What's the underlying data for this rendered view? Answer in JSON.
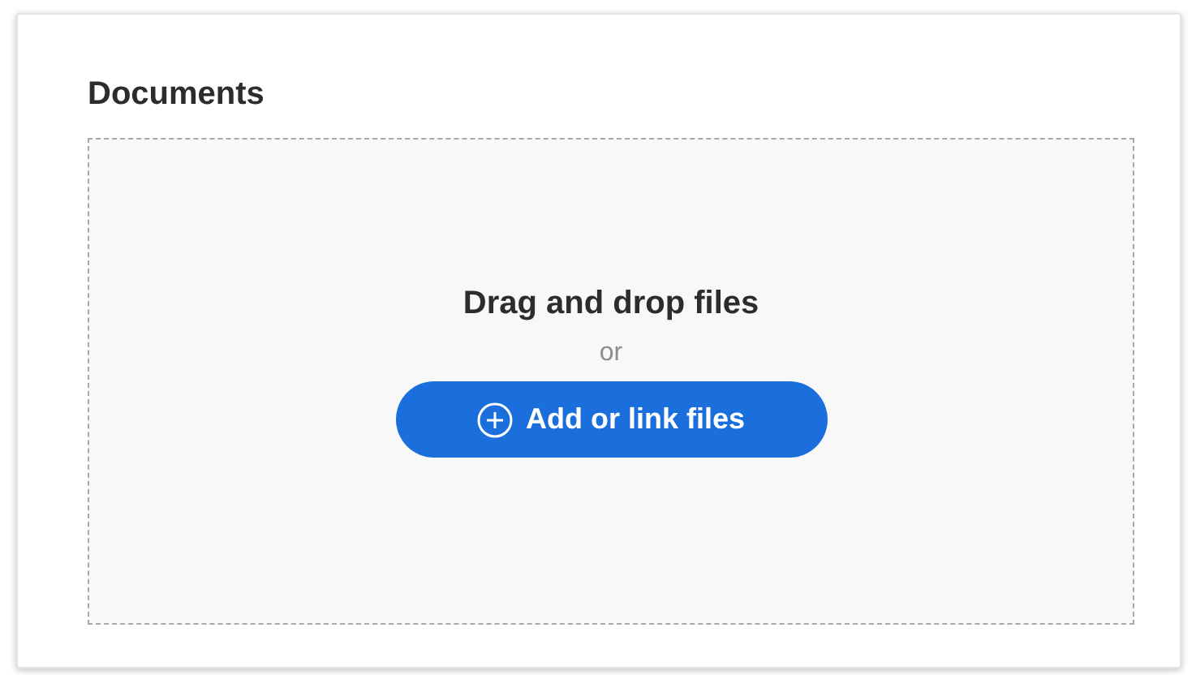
{
  "section": {
    "title": "Documents"
  },
  "dropzone": {
    "heading": "Drag and drop files",
    "separator": "or",
    "button": {
      "label": "Add or link files"
    }
  }
}
